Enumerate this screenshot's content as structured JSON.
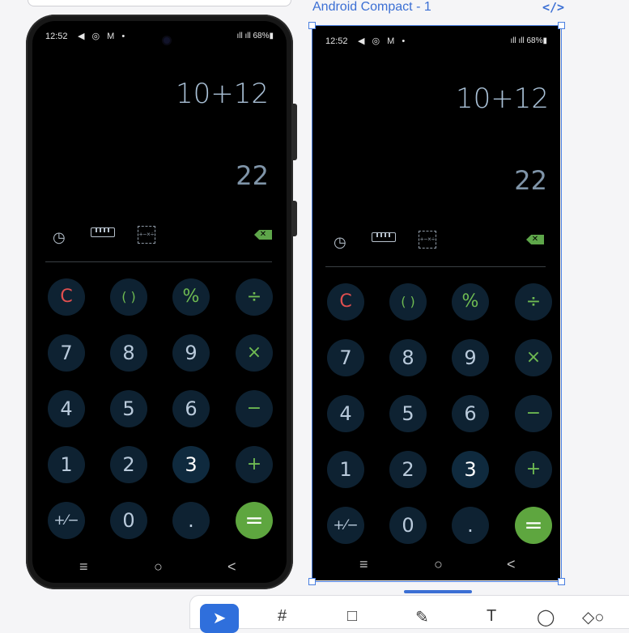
{
  "frame": {
    "title": "Android Compact - 1",
    "code_icon": "</>"
  },
  "status": {
    "time": "12:52",
    "icons": "◀ ◎ M •",
    "right": "ıll ıll 68%▮"
  },
  "display": {
    "expression": "10+12",
    "result": "22"
  },
  "tools": {
    "history_icon": "◷",
    "calc_icon_label": "+−×÷",
    "backspace_icon": "✕"
  },
  "keys": {
    "clear": "C",
    "paren": "( )",
    "percent": "%",
    "divide": "÷",
    "n7": "7",
    "n8": "8",
    "n9": "9",
    "multiply": "×",
    "n4": "4",
    "n5": "5",
    "n6": "6",
    "minus": "−",
    "n1": "1",
    "n2": "2",
    "n3": "3",
    "plus": "+",
    "plusminus": "+⁄−",
    "n0": "0",
    "dot": ".",
    "equals": "="
  },
  "nav": {
    "recents": "≡",
    "home": "○",
    "back": "<"
  },
  "toolbar": {
    "move": "➤",
    "frame": "#",
    "rect": "□",
    "pen": "✎",
    "text": "T",
    "comment": "◯",
    "more": "◇○"
  },
  "colors": {
    "accent_green": "#5ea63f",
    "clear_red": "#e04f4f",
    "key_bg": "#0e2232",
    "selection_blue": "#4a7fe0"
  }
}
